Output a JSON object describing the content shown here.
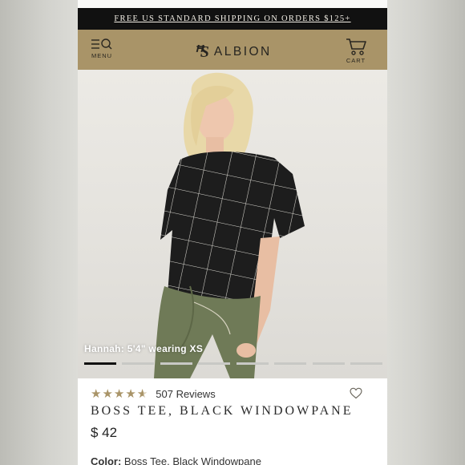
{
  "promo": {
    "text": "FREE US STANDARD SHIPPING ON ORDERS $125+"
  },
  "header": {
    "menu_label": "MENU",
    "logo_mark": "ꟸS",
    "logo_text": "ALBION",
    "cart_label": "CART",
    "bg_color": "#a99468"
  },
  "hero": {
    "caption": "Hannah: 5'4\" wearing XS",
    "slide_count": 8,
    "active_slide": 1
  },
  "product": {
    "rating": 4.5,
    "stars": [
      "★",
      "★",
      "★",
      "★",
      "★"
    ],
    "reviews": "507 Reviews",
    "title": "BOSS TEE, BLACK WINDOWPANE",
    "price": "$ 42",
    "color_label": "Color:",
    "color_value": "Boss Tee, Black Windowpane"
  },
  "colors": {
    "accent": "#a99468",
    "promo_bg": "#111111"
  }
}
